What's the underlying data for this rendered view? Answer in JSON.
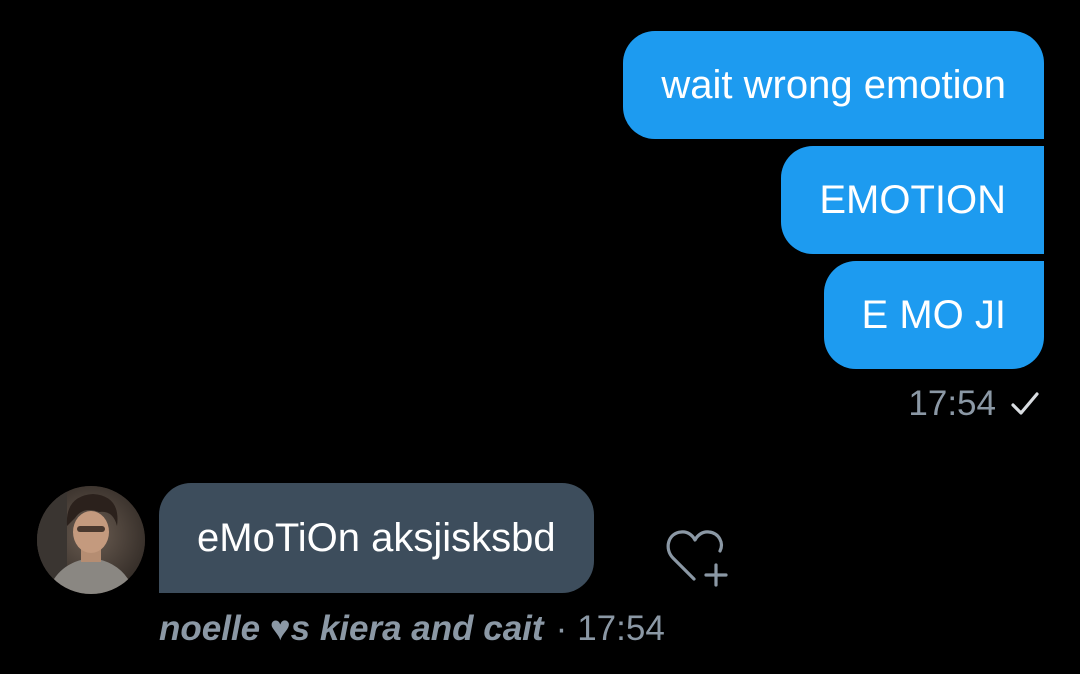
{
  "outgoing": {
    "messages": [
      "wait wrong emotion",
      "EMOTION",
      "E MO JI"
    ],
    "time": "17:54",
    "status_icon": "check-icon"
  },
  "incoming": {
    "avatar_icon": "avatar",
    "message": "eMoTiOn aksjisksbd",
    "sender": "noelle ♥s kiera and cait",
    "separator": "·",
    "time": "17:54",
    "reaction_icon": "heart-plus-icon"
  },
  "colors": {
    "background": "#000000",
    "outgoing_bubble": "#1d9bf0",
    "incoming_bubble": "#3d4d5c",
    "meta_text": "#8b98a5"
  }
}
